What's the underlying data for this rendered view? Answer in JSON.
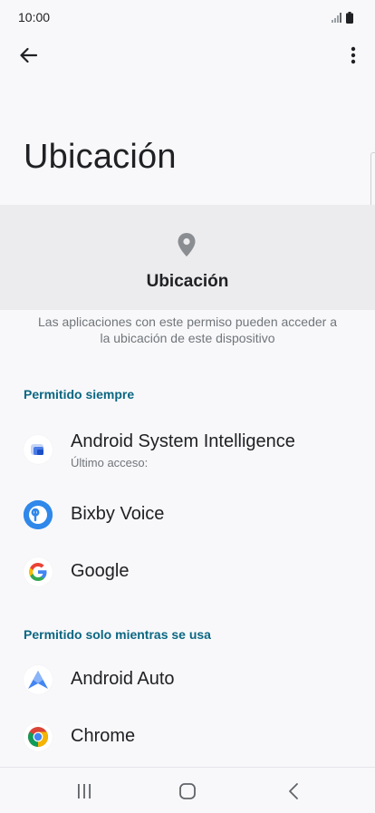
{
  "status": {
    "time": "10:00"
  },
  "toolbar": {
    "back_icon": "arrow-left-icon",
    "more_icon": "more-vert-icon"
  },
  "page": {
    "title": "Ubicación"
  },
  "permission": {
    "icon": "location-pin-icon",
    "name": "Ubicación",
    "description": "Las aplicaciones con este permiso pueden acceder a la ubicación de este dispositivo"
  },
  "sections": {
    "always": {
      "header": "Permitido siempre",
      "apps": [
        {
          "name": "Android System Intelligence",
          "subtitle": "Último acceso:"
        },
        {
          "name": "Bixby Voice"
        },
        {
          "name": "Google"
        }
      ]
    },
    "while_in_use": {
      "header": "Permitido solo mientras se usa",
      "apps": [
        {
          "name": "Android Auto"
        },
        {
          "name": "Chrome"
        }
      ]
    }
  },
  "colors": {
    "accent": "#0b6782",
    "header_bg": "#ececee",
    "bg": "#f8f8fa"
  },
  "nav": {
    "recents_icon": "recents-icon",
    "home_icon": "home-icon",
    "back_icon": "back-chevron-icon"
  }
}
